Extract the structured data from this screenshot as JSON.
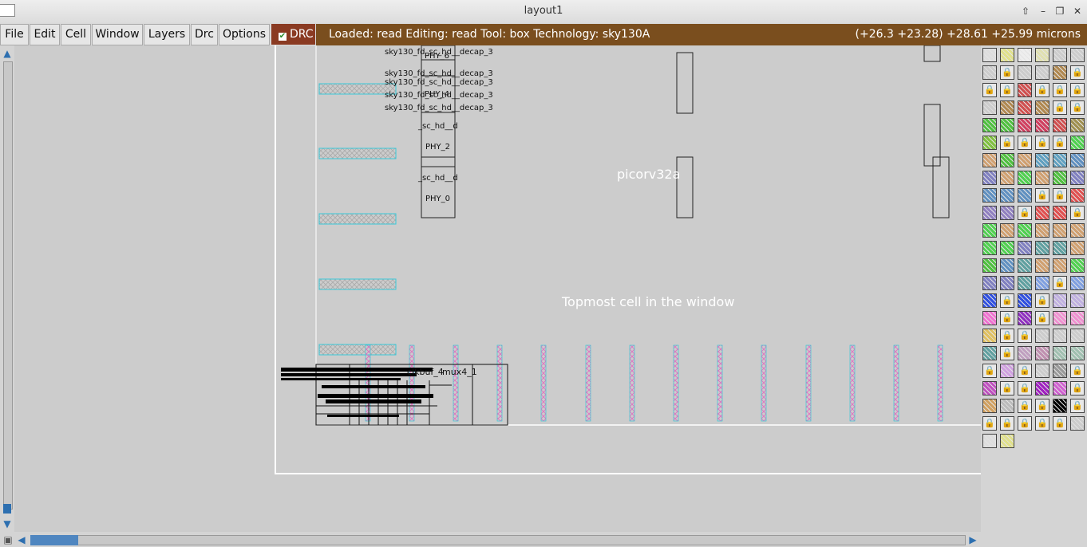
{
  "window": {
    "title": "layout1"
  },
  "menus": [
    "File",
    "Edit",
    "Cell",
    "Window",
    "Layers",
    "Drc",
    "Options"
  ],
  "drc": {
    "label": "DRC",
    "checked": true
  },
  "status": {
    "text": "Loaded: read Editing: read Tool: box  Technology: sky130A",
    "coords": "(+26.3 +23.28) +28.61 +25.99 microns"
  },
  "canvas": {
    "cell_name": "picorv32a",
    "topmost_label": "Topmost cell in the window",
    "decap_labels": [
      "sky130_fd_sc_hd__decap_3",
      "sky130_fd_sc_hd__decap_3",
      "sky130_fd_sc_hd__decap_3",
      "sky130_fd_sc_hd__decap_3",
      "sky130_fd_sc_hd__decap_3"
    ],
    "phy_labels": [
      "PHY_6",
      "PHY_4",
      "PHY_2",
      "PHY_0"
    ],
    "cell_fragments": [
      "_sc_hd__d",
      "_sc_hd__d",
      "clkbuf_4",
      "mux4_1"
    ]
  },
  "colors": {
    "status_bg": "#7a4e1e",
    "drc_bg": "#8a3a22",
    "scroll_accent": "#2d6fb0",
    "canvas_bg": "#cccccc"
  },
  "icons": {
    "up_arrow": "up-arrow-icon",
    "down_arrow": "down-arrow-icon",
    "left_arrow": "left-arrow-icon",
    "right_arrow": "right-arrow-icon",
    "lock": "lock-icon"
  }
}
